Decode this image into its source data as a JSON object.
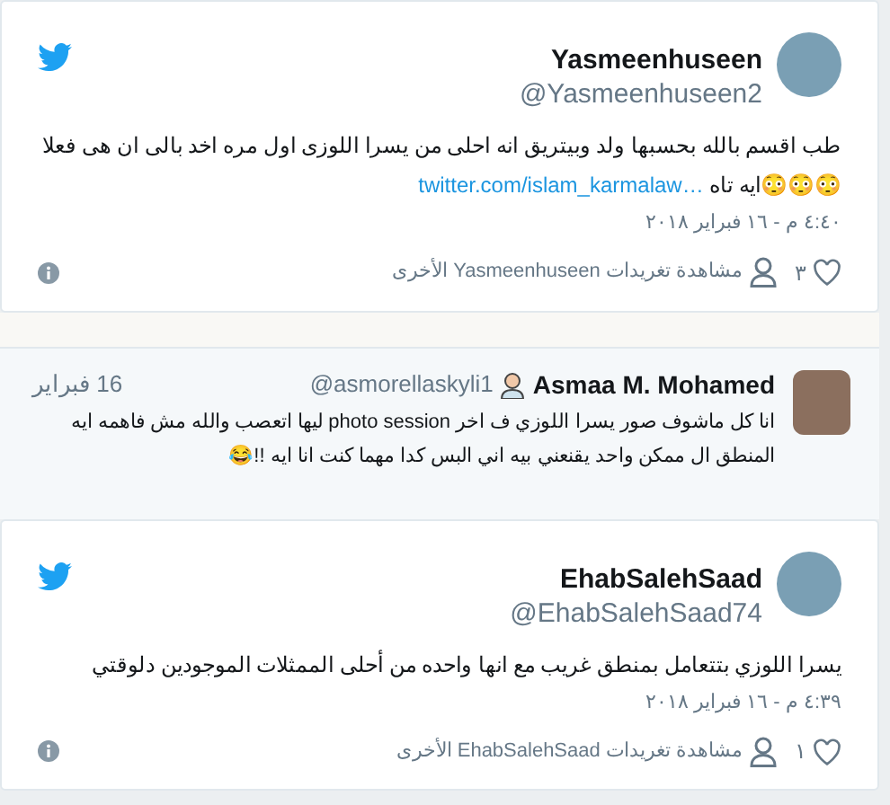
{
  "items": [
    {
      "kind": "tweet",
      "name": "Yasmeenhuseen",
      "handle": "@Yasmeenhuseen2",
      "text": "طب اقسم بالله بحسبها ولد وبيتريق انه احلى من يسرا اللوزى اول مره اخد بالى ان هى فعلا😳😳😳ايه تاه ",
      "link": "twitter.com/islam_karmalaw…",
      "time": "٤:٤٠ م - ١٦ فبراير ٢٠١٨",
      "likes": "٣",
      "more": "مشاهدة تغريدات Yasmeenhuseen الأخرى"
    },
    {
      "kind": "reply",
      "name": "Asmaa M. Mohamed",
      "handle": "@asmorellaskyli1",
      "date": "16 فبراير",
      "text": "انا كل ماشوف صور يسرا اللوزي ف اخر photo session ليها اتعصب والله مش فاهمه ايه المنطق ال ممكن واحد يقنعني بيه اني البس كدا مهما كنت انا ايه !!😂"
    },
    {
      "kind": "tweet",
      "name": "EhabSalehSaad",
      "handle": "@EhabSalehSaad74",
      "text": "يسرا اللوزي بتتعامل بمنطق غريب مع انها واحده من أحلى الممثلات الموجودين دلوقتي",
      "time": "٤:٣٩ م - ١٦ فبراير ٢٠١٨",
      "likes": "١",
      "more": "مشاهدة تغريدات EhabSalehSaad الأخرى"
    }
  ]
}
